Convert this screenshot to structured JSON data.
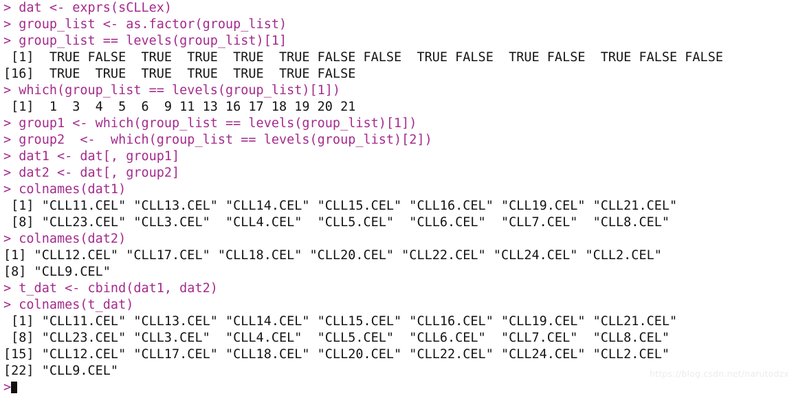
{
  "terminal": {
    "app": "R console",
    "prompt_symbol": ">",
    "colors": {
      "background": "#ffffff",
      "command_text": "#a52a8c",
      "output_text": "#141414",
      "cursor": "#111111",
      "watermark": "#ececec"
    },
    "lines": [
      {
        "type": "command",
        "text": "> dat <- exprs(sCLLex)"
      },
      {
        "type": "command",
        "text": "> group_list <- as.factor(group_list)"
      },
      {
        "type": "command",
        "text": "> group_list == levels(group_list)[1]"
      },
      {
        "type": "output",
        "text": " [1]  TRUE FALSE  TRUE  TRUE  TRUE  TRUE FALSE FALSE  TRUE FALSE  TRUE FALSE  TRUE FALSE FALSE"
      },
      {
        "type": "output",
        "text": "[16]  TRUE  TRUE  TRUE  TRUE  TRUE  TRUE FALSE"
      },
      {
        "type": "command",
        "text": "> which(group_list == levels(group_list)[1])"
      },
      {
        "type": "output",
        "text": " [1]  1  3  4  5  6  9 11 13 16 17 18 19 20 21"
      },
      {
        "type": "command",
        "text": "> group1 <- which(group_list == levels(group_list)[1])"
      },
      {
        "type": "command",
        "text": "> group2  <-  which(group_list == levels(group_list)[2])"
      },
      {
        "type": "command",
        "text": "> dat1 <- dat[, group1]"
      },
      {
        "type": "command",
        "text": "> dat2 <- dat[, group2]"
      },
      {
        "type": "command",
        "text": "> colnames(dat1)"
      },
      {
        "type": "output",
        "text": " [1] \"CLL11.CEL\" \"CLL13.CEL\" \"CLL14.CEL\" \"CLL15.CEL\" \"CLL16.CEL\" \"CLL19.CEL\" \"CLL21.CEL\""
      },
      {
        "type": "output",
        "text": " [8] \"CLL23.CEL\" \"CLL3.CEL\"  \"CLL4.CEL\"  \"CLL5.CEL\"  \"CLL6.CEL\"  \"CLL7.CEL\"  \"CLL8.CEL\""
      },
      {
        "type": "command",
        "text": "> colnames(dat2)"
      },
      {
        "type": "output",
        "text": "[1] \"CLL12.CEL\" \"CLL17.CEL\" \"CLL18.CEL\" \"CLL20.CEL\" \"CLL22.CEL\" \"CLL24.CEL\" \"CLL2.CEL\""
      },
      {
        "type": "output",
        "text": "[8] \"CLL9.CEL\""
      },
      {
        "type": "command",
        "text": "> t_dat <- cbind(dat1, dat2)"
      },
      {
        "type": "command",
        "text": "> colnames(t_dat)"
      },
      {
        "type": "output",
        "text": " [1] \"CLL11.CEL\" \"CLL13.CEL\" \"CLL14.CEL\" \"CLL15.CEL\" \"CLL16.CEL\" \"CLL19.CEL\" \"CLL21.CEL\""
      },
      {
        "type": "output",
        "text": " [8] \"CLL23.CEL\" \"CLL3.CEL\"  \"CLL4.CEL\"  \"CLL5.CEL\"  \"CLL6.CEL\"  \"CLL7.CEL\"  \"CLL8.CEL\""
      },
      {
        "type": "output",
        "text": "[15] \"CLL12.CEL\" \"CLL17.CEL\" \"CLL18.CEL\" \"CLL20.CEL\" \"CLL22.CEL\" \"CLL24.CEL\" \"CLL2.CEL\""
      },
      {
        "type": "output",
        "text": "[22] \"CLL9.CEL\""
      }
    ],
    "last_prompt": ">",
    "watermark": "https://blog.csdn.net/narutodzx"
  },
  "results": {
    "logical_vector_label_1": "[1]",
    "logical_vector_label_16": "[16]",
    "logical_values": [
      "TRUE",
      "FALSE",
      "TRUE",
      "TRUE",
      "TRUE",
      "TRUE",
      "FALSE",
      "FALSE",
      "TRUE",
      "FALSE",
      "TRUE",
      "FALSE",
      "TRUE",
      "FALSE",
      "FALSE",
      "TRUE",
      "TRUE",
      "TRUE",
      "TRUE",
      "TRUE",
      "TRUE",
      "FALSE"
    ],
    "group1_indices": [
      1,
      3,
      4,
      5,
      6,
      9,
      11,
      13,
      16,
      17,
      18,
      19,
      20,
      21
    ],
    "dat1_colnames": [
      "CLL11.CEL",
      "CLL13.CEL",
      "CLL14.CEL",
      "CLL15.CEL",
      "CLL16.CEL",
      "CLL19.CEL",
      "CLL21.CEL",
      "CLL23.CEL",
      "CLL3.CEL",
      "CLL4.CEL",
      "CLL5.CEL",
      "CLL6.CEL",
      "CLL7.CEL",
      "CLL8.CEL"
    ],
    "dat2_colnames": [
      "CLL12.CEL",
      "CLL17.CEL",
      "CLL18.CEL",
      "CLL20.CEL",
      "CLL22.CEL",
      "CLL24.CEL",
      "CLL2.CEL",
      "CLL9.CEL"
    ],
    "t_dat_colnames": [
      "CLL11.CEL",
      "CLL13.CEL",
      "CLL14.CEL",
      "CLL15.CEL",
      "CLL16.CEL",
      "CLL19.CEL",
      "CLL21.CEL",
      "CLL23.CEL",
      "CLL3.CEL",
      "CLL4.CEL",
      "CLL5.CEL",
      "CLL6.CEL",
      "CLL7.CEL",
      "CLL8.CEL",
      "CLL12.CEL",
      "CLL17.CEL",
      "CLL18.CEL",
      "CLL20.CEL",
      "CLL22.CEL",
      "CLL24.CEL",
      "CLL2.CEL",
      "CLL9.CEL"
    ]
  }
}
